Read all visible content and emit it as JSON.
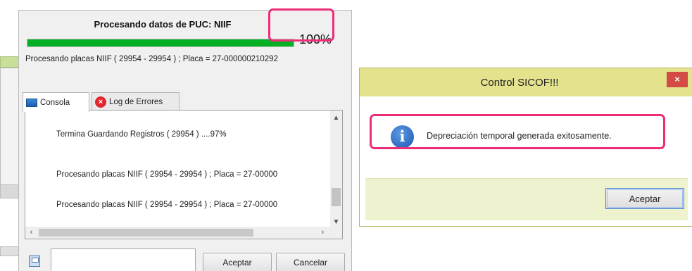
{
  "processing": {
    "title": "Procesando datos de PUC: NIIF",
    "progress_value": 1.0,
    "percent_label": "100%",
    "status_line": "Procesando placas NIIF ( 29954 - 29954 ) ; Placa = 27-000000210292",
    "tabs": [
      {
        "label": "Consola",
        "icon": "console-icon",
        "active": true
      },
      {
        "label": "Log de Errores",
        "icon": "error-icon",
        "active": false
      }
    ],
    "console_lines": [
      "Termina Guardando Registros ( 29954 ) ....97%",
      "Procesando placas NIIF ( 29954 - 29954 ) ; Placa = 27-00000",
      "Procesando placas NIIF ( 29954 - 29954 ) ; Placa = 27-00000"
    ],
    "buttons": {
      "accept": "Aceptar",
      "cancel": "Cancelar"
    }
  },
  "dialog": {
    "title": "Control SICOF!!!",
    "close_glyph": "×",
    "icon": "info-icon",
    "message": "Depreciación temporal generada exitosamente.",
    "button": "Aceptar"
  },
  "colors": {
    "progress_green": "#06b025",
    "highlight_pink": "#ee2d78",
    "dialog_title_bg": "#e4e28d",
    "close_red": "#d34b44"
  }
}
